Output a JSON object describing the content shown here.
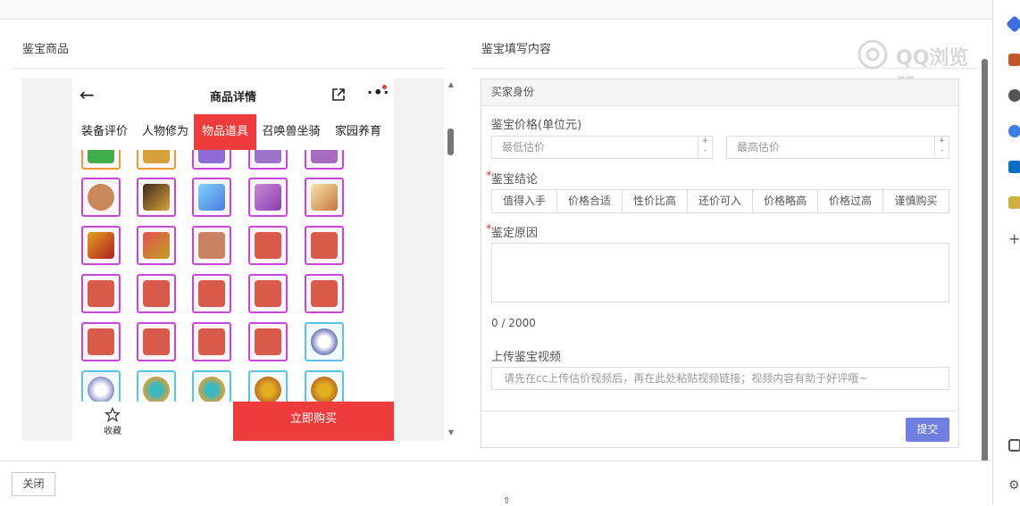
{
  "left_section": {
    "title": "鉴宝商品"
  },
  "right_section": {
    "title": "鉴宝填写内容"
  },
  "phone": {
    "title": "商品详情",
    "tabs": [
      "装备评价",
      "人物修为",
      "物品道具",
      "召唤兽坐骑",
      "家园养育"
    ],
    "active_tab": "物品道具",
    "fav_label": "收藏",
    "buy_label": "立即购买"
  },
  "form": {
    "header": "买家身份",
    "price_label": "鉴宝价格(单位元)",
    "min_placeholder": "最低估价",
    "max_placeholder": "最高估价",
    "conclusion_label": "鉴宝结论",
    "conclusions": [
      "值得入手",
      "价格合适",
      "性价比高",
      "还价可入",
      "价格略高",
      "价格过高",
      "谨慎购买"
    ],
    "reason_label": "鉴定原因",
    "counter": "0 / 2000",
    "video_label": "上传鉴宝视频",
    "video_placeholder": "请先在cc上传估价视频后，再在此处粘贴视频链接；视频内容有助于好评哦~",
    "submit_label": "提交"
  },
  "footer": {
    "close_label": "关闭"
  },
  "watermark": "QQ浏览器",
  "colors": {
    "accent_red": "#ee3b3b",
    "submit_blue": "#6e7fe0",
    "purple_border": "#c847d8",
    "blue_border": "#5fc3e8"
  }
}
